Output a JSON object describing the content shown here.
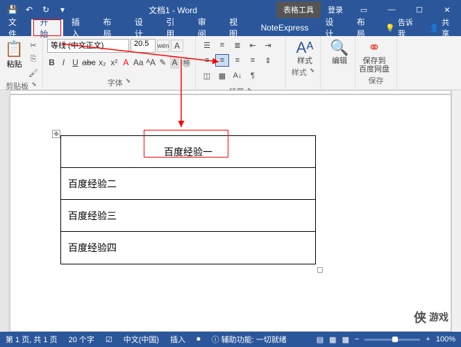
{
  "titlebar": {
    "doc_title": "文档1 - Word",
    "table_tools": "表格工具",
    "login": "登录"
  },
  "tabs": {
    "file": "文件",
    "home": "开始",
    "insert": "插入",
    "layout": "布局",
    "design": "设计",
    "references": "引用",
    "review": "审阅",
    "view": "视图",
    "noteexpress": "NoteExpress",
    "tt_design": "设计",
    "tt_layout": "布局",
    "tell": "告诉我",
    "share": "共享"
  },
  "ribbon": {
    "clipboard": {
      "label": "剪贴板",
      "paste": "粘贴"
    },
    "font": {
      "label": "字体",
      "name": "等线 (中文正文)",
      "size": "20.5",
      "wen": "wén"
    },
    "paragraph": {
      "label": "段落"
    },
    "styles": {
      "label": "样式",
      "btn": "样式"
    },
    "editing": {
      "label": "编辑",
      "btn": "编辑"
    },
    "save": {
      "label": "保存",
      "btn": "保存到\n百度网盘"
    }
  },
  "table": {
    "rows": [
      "百度经验一",
      "百度经验二",
      "百度经验三",
      "百度经验四"
    ]
  },
  "statusbar": {
    "page": "第 1 页, 共 1 页",
    "words": "20 个字",
    "lang": "中文(中国)",
    "insert": "插入",
    "a11y": "辅助功能: 一切就绪",
    "zoom": "100%"
  },
  "watermark": {
    "brand": "侠",
    "text": "游戏"
  },
  "colors": {
    "accent": "#2b579a",
    "highlight_red": "#ff0000"
  }
}
